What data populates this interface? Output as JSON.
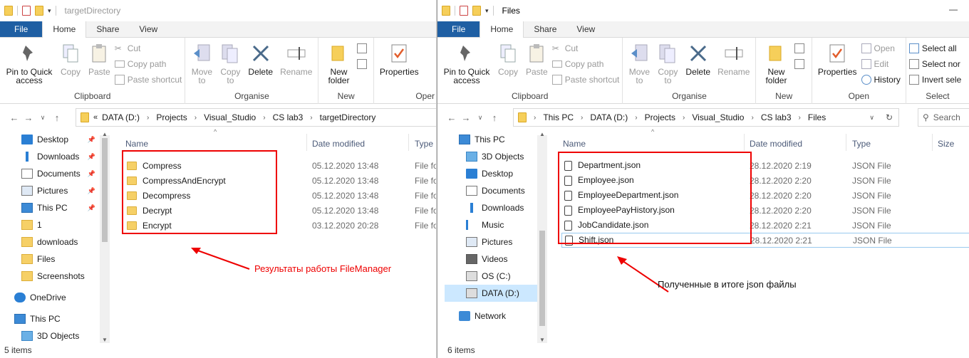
{
  "left": {
    "title": "targetDirectory",
    "tabs": [
      "File",
      "Home",
      "Share",
      "View"
    ],
    "ribbon": {
      "clipboard": {
        "label": "Clipboard",
        "pin": "Pin to Quick access",
        "copy": "Copy",
        "paste": "Paste",
        "cut": "Cut",
        "copy_path": "Copy path",
        "paste_shortcut": "Paste shortcut"
      },
      "organise": {
        "label": "Organise",
        "move_to": "Move to",
        "copy_to": "Copy to",
        "delete": "Delete",
        "rename": "Rename"
      },
      "new": {
        "label": "New",
        "new_folder": "New folder"
      },
      "open": {
        "properties": "Properties",
        "label": "Oper"
      }
    },
    "address": [
      "DATA (D:)",
      "Projects",
      "Visual_Studio",
      "CS lab3",
      "targetDirectory"
    ],
    "nav": [
      {
        "label": "Desktop",
        "icon": "desktop-icon",
        "pinned": true
      },
      {
        "label": "Downloads",
        "icon": "download-icon",
        "pinned": true
      },
      {
        "label": "Documents",
        "icon": "documents-icon",
        "pinned": true
      },
      {
        "label": "Pictures",
        "icon": "pictures-icon",
        "pinned": true
      },
      {
        "label": "This PC",
        "icon": "pc-icon",
        "pinned": true
      },
      {
        "label": "1",
        "icon": "folder-icon",
        "pinned": false
      },
      {
        "label": "downloads",
        "icon": "folder-icon",
        "pinned": false
      },
      {
        "label": "Files",
        "icon": "folder-icon",
        "pinned": false
      },
      {
        "label": "Screenshots",
        "icon": "folder-icon",
        "pinned": false
      },
      {
        "label": "OneDrive",
        "icon": "cloud-icon",
        "pinned": false
      },
      {
        "label": "This PC",
        "icon": "pc-icon",
        "pinned": false
      },
      {
        "label": "3D Objects",
        "icon": "cube-icon",
        "pinned": false
      }
    ],
    "columns": {
      "name": "Name",
      "date": "Date modified",
      "type": "Type"
    },
    "files": [
      {
        "name": "Compress",
        "date": "05.12.2020 13:48",
        "type": "File fo"
      },
      {
        "name": "CompressAndEncrypt",
        "date": "05.12.2020 13:48",
        "type": "File fo"
      },
      {
        "name": "Decompress",
        "date": "05.12.2020 13:48",
        "type": "File fo"
      },
      {
        "name": "Decrypt",
        "date": "05.12.2020 13:48",
        "type": "File fo"
      },
      {
        "name": "Encrypt",
        "date": "03.12.2020 20:28",
        "type": "File fo"
      }
    ],
    "status": "5 items",
    "annotation": "Результаты работы FileManager"
  },
  "right": {
    "title": "Files",
    "tabs": [
      "File",
      "Home",
      "Share",
      "View"
    ],
    "ribbon": {
      "clipboard": {
        "label": "Clipboard",
        "pin": "Pin to Quick access",
        "copy": "Copy",
        "paste": "Paste",
        "cut": "Cut",
        "copy_path": "Copy path",
        "paste_shortcut": "Paste shortcut"
      },
      "organise": {
        "label": "Organise",
        "move_to": "Move to",
        "copy_to": "Copy to",
        "delete": "Delete",
        "rename": "Rename"
      },
      "new": {
        "label": "New",
        "new_folder": "New folder"
      },
      "open": {
        "label": "Open",
        "properties": "Properties",
        "open": "Open",
        "edit": "Edit",
        "history": "History"
      },
      "select": {
        "label": "Select",
        "select_all": "Select all",
        "select_none": "Select nor",
        "invert": "Invert sele"
      }
    },
    "address": [
      "This PC",
      "DATA (D:)",
      "Projects",
      "Visual_Studio",
      "CS lab3",
      "Files"
    ],
    "search_placeholder": "Search",
    "nav": [
      {
        "label": "This PC",
        "icon": "pc-icon",
        "sel": false
      },
      {
        "label": "3D Objects",
        "icon": "cube-icon",
        "sel": false
      },
      {
        "label": "Desktop",
        "icon": "desktop-icon",
        "sel": false
      },
      {
        "label": "Documents",
        "icon": "documents-icon",
        "sel": false
      },
      {
        "label": "Downloads",
        "icon": "download-icon",
        "sel": false
      },
      {
        "label": "Music",
        "icon": "music-icon",
        "sel": false
      },
      {
        "label": "Pictures",
        "icon": "pictures-icon",
        "sel": false
      },
      {
        "label": "Videos",
        "icon": "videos-icon",
        "sel": false
      },
      {
        "label": "OS (C:)",
        "icon": "drive-icon",
        "sel": false
      },
      {
        "label": "DATA (D:)",
        "icon": "drive-icon",
        "sel": true
      },
      {
        "label": "Network",
        "icon": "network-icon",
        "sel": false
      }
    ],
    "columns": {
      "name": "Name",
      "date": "Date modified",
      "type": "Type",
      "size": "Size"
    },
    "files": [
      {
        "name": "Department.json",
        "date": "28.12.2020 2:19",
        "type": "JSON File"
      },
      {
        "name": "Employee.json",
        "date": "28.12.2020 2:20",
        "type": "JSON File"
      },
      {
        "name": "EmployeeDepartment.json",
        "date": "28.12.2020 2:20",
        "type": "JSON File"
      },
      {
        "name": "EmployeePayHistory.json",
        "date": "28.12.2020 2:20",
        "type": "JSON File"
      },
      {
        "name": "JobCandidate.json",
        "date": "28.12.2020 2:21",
        "type": "JSON File"
      },
      {
        "name": "Shift.json",
        "date": "28.12.2020 2:21",
        "type": "JSON File"
      }
    ],
    "status": "6 items",
    "annotation": "Полученные в итоге json файлы"
  },
  "colors": {
    "file_tab": "#1f5fa3",
    "annotation_red": "#e00000",
    "selection": "#cce8ff"
  }
}
